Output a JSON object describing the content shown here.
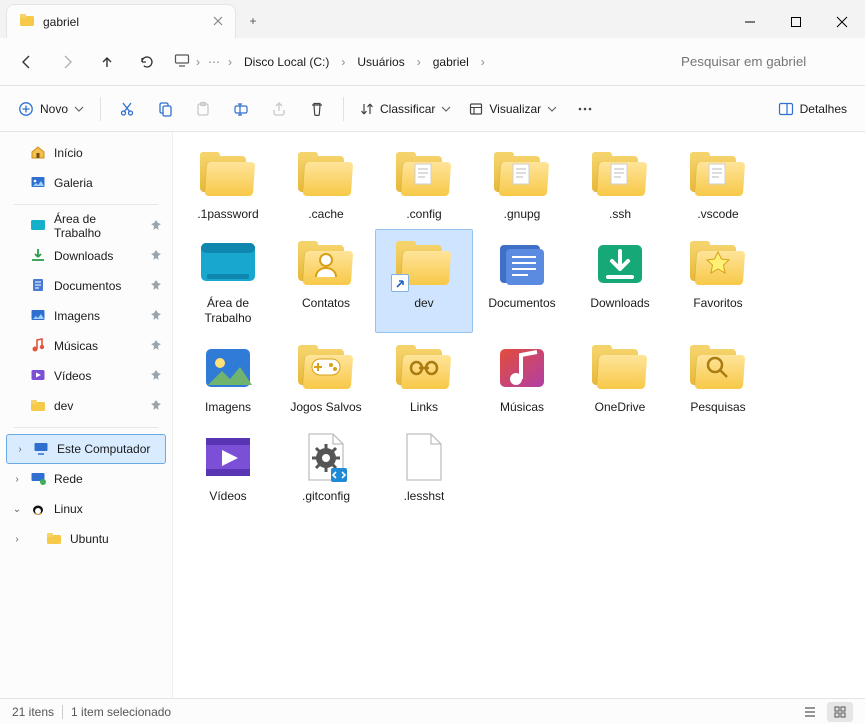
{
  "window": {
    "tab_title": "gabriel",
    "min": "—",
    "max": "▢",
    "close": "✕",
    "newtab": "+"
  },
  "nav": {
    "back_disabled": false,
    "forward_disabled": true,
    "breadcrumbs": [
      "Disco Local (C:)",
      "Usuários",
      "gabriel"
    ],
    "search_placeholder": "Pesquisar em gabriel"
  },
  "toolbar": {
    "new": "Novo",
    "sort": "Classificar",
    "view": "Visualizar",
    "details": "Detalhes"
  },
  "sidebar": {
    "top": [
      {
        "label": "Início",
        "icon": "home"
      },
      {
        "label": "Galeria",
        "icon": "gallery"
      }
    ],
    "quick": [
      {
        "label": "Área de Trabalho",
        "icon": "desktop-blue",
        "pinned": true
      },
      {
        "label": "Downloads",
        "icon": "download-green",
        "pinned": true
      },
      {
        "label": "Documentos",
        "icon": "doc-blue",
        "pinned": true
      },
      {
        "label": "Imagens",
        "icon": "image-blue",
        "pinned": true
      },
      {
        "label": "Músicas",
        "icon": "music-red",
        "pinned": true
      },
      {
        "label": "Vídeos",
        "icon": "video-purple",
        "pinned": true
      },
      {
        "label": "dev",
        "icon": "folder-yellow",
        "pinned": true
      }
    ],
    "tree": [
      {
        "label": "Este Computador",
        "icon": "pc",
        "expander": ">",
        "selected": true
      },
      {
        "label": "Rede",
        "icon": "network",
        "expander": ">"
      },
      {
        "label": "Linux",
        "icon": "linux",
        "expander": "v"
      },
      {
        "label": "Ubuntu",
        "icon": "folder-yellow",
        "indent": true
      }
    ]
  },
  "content": {
    "items": [
      {
        "label": ".1password",
        "kind": "folder"
      },
      {
        "label": ".cache",
        "kind": "folder"
      },
      {
        "label": ".config",
        "kind": "folder-doc"
      },
      {
        "label": ".gnupg",
        "kind": "folder-doc"
      },
      {
        "label": ".ssh",
        "kind": "folder-doc"
      },
      {
        "label": ".vscode",
        "kind": "folder-doc"
      },
      {
        "label": "Área de Trabalho",
        "kind": "desktop"
      },
      {
        "label": "Contatos",
        "kind": "contacts"
      },
      {
        "label": "dev",
        "kind": "folder",
        "selected": true,
        "shortcut": true
      },
      {
        "label": "Documentos",
        "kind": "documents"
      },
      {
        "label": "Downloads",
        "kind": "downloads"
      },
      {
        "label": "Favoritos",
        "kind": "favorites"
      },
      {
        "label": "Imagens",
        "kind": "images"
      },
      {
        "label": "Jogos Salvos",
        "kind": "games"
      },
      {
        "label": "Links",
        "kind": "links"
      },
      {
        "label": "Músicas",
        "kind": "music"
      },
      {
        "label": "OneDrive",
        "kind": "folder"
      },
      {
        "label": "Pesquisas",
        "kind": "search-folder"
      },
      {
        "label": "Vídeos",
        "kind": "videos"
      },
      {
        "label": ".gitconfig",
        "kind": "gitconfig"
      },
      {
        "label": ".lesshst",
        "kind": "blank-file"
      }
    ]
  },
  "status": {
    "count": "21 itens",
    "selection": "1 item selecionado"
  }
}
